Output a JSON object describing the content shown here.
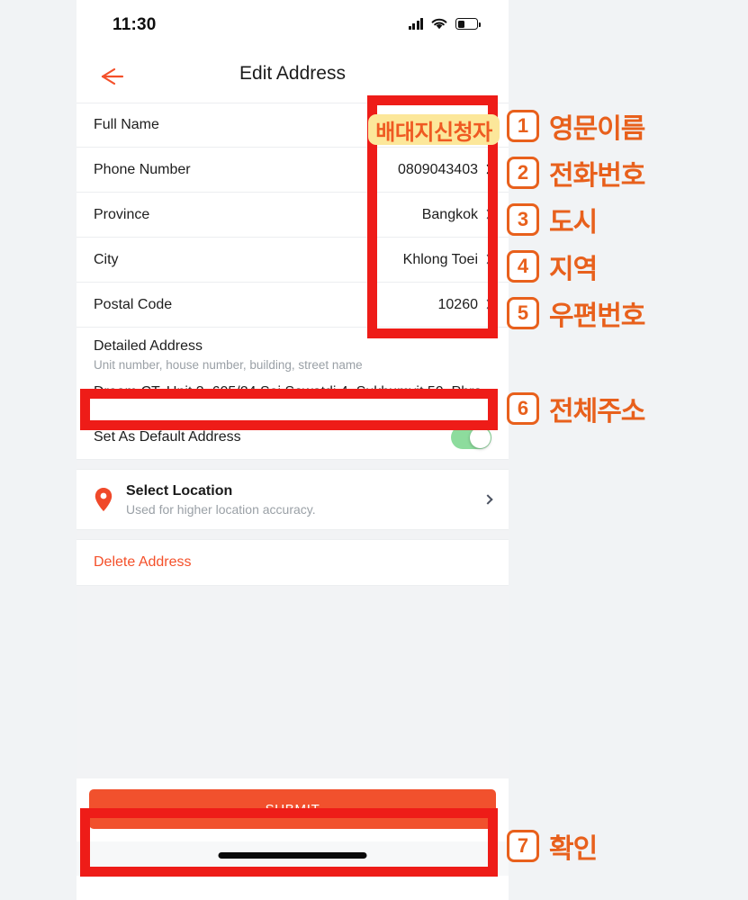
{
  "status_bar": {
    "time": "11:30",
    "signal_icon": "cellular-signal-icon",
    "wifi_icon": "wifi-icon",
    "battery_icon": "battery-low-icon"
  },
  "nav": {
    "title": "Edit Address",
    "back_icon": "arrow-left-icon"
  },
  "form": {
    "fields": [
      {
        "label": "Full Name",
        "value": "",
        "has_chevron": false
      },
      {
        "label": "Phone Number",
        "value": "0809043403",
        "has_chevron": true
      },
      {
        "label": "Province",
        "value": "Bangkok",
        "has_chevron": true
      },
      {
        "label": "City",
        "value": "Khlong Toei",
        "has_chevron": true
      },
      {
        "label": "Postal Code",
        "value": "10260",
        "has_chevron": true
      }
    ],
    "detailed": {
      "title": "Detailed Address",
      "hint": "Unit number, house number, building, street name",
      "value": "Dream CT, Unit 3, 605/24 Soi Sawatdi 4, Sukhumvit 50, Phra"
    },
    "default_address": {
      "label": "Set As Default Address",
      "toggle_on": true,
      "toggle_color": "#8ddc9d"
    },
    "select_location": {
      "title": "Select Location",
      "subtitle": "Used for higher location accuracy.",
      "pin_icon": "map-pin-icon",
      "chevron_icon": "chevron-right-icon"
    },
    "delete_label": "Delete Address",
    "submit_label": "SUBMIT"
  },
  "annotations": {
    "highlight_sticker": "배대지신청자",
    "accent_color": "#e8601c",
    "box_color": "#ee1c18",
    "items": [
      {
        "num": "1",
        "text": "영문이름"
      },
      {
        "num": "2",
        "text": "전화번호"
      },
      {
        "num": "3",
        "text": "도시"
      },
      {
        "num": "4",
        "text": "지역"
      },
      {
        "num": "5",
        "text": "우편번호"
      },
      {
        "num": "6",
        "text": "전체주소"
      },
      {
        "num": "7",
        "text": "확인"
      }
    ]
  }
}
